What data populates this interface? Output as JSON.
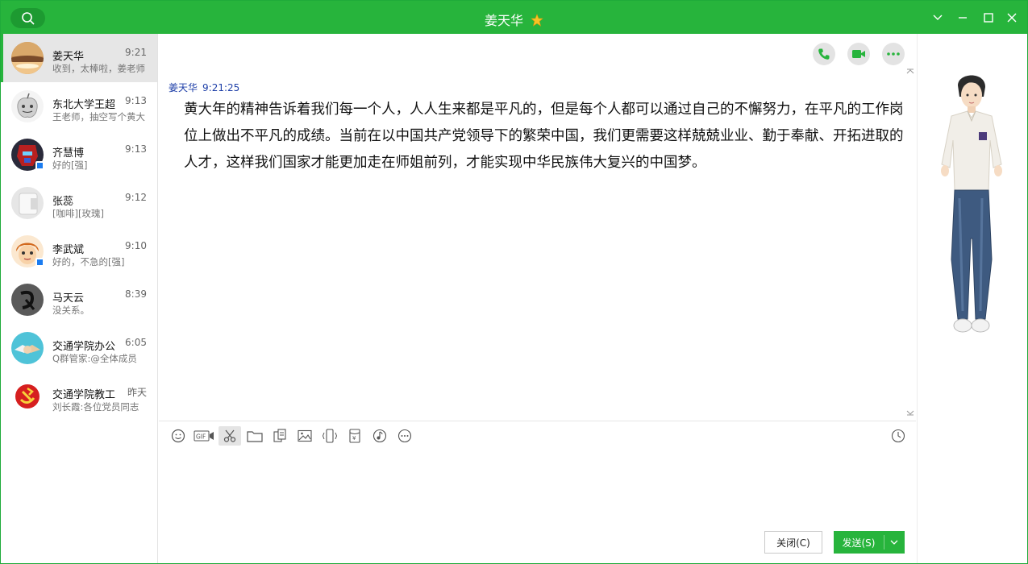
{
  "title": "姜天华",
  "colors": {
    "accent": "#27b43c",
    "sender_name": "#1e3fa8"
  },
  "conversations": [
    {
      "name": "姜天华",
      "time": "9:21",
      "preview": "收到，太棒啦，姜老师",
      "active": true,
      "avatar_icon": "sunset-avatar"
    },
    {
      "name": "东北大学王超",
      "time": "9:13",
      "preview": "王老师，抽空写个黄大",
      "avatar_icon": "apple-avatar"
    },
    {
      "name": "齐慧博",
      "time": "9:13",
      "preview": "好的[强]",
      "avatar_icon": "robot-avatar"
    },
    {
      "name": "张蕊",
      "time": "9:12",
      "preview": "[咖啡][玫瑰]",
      "avatar_icon": "default-gray-avatar"
    },
    {
      "name": "李武斌",
      "time": "9:10",
      "preview": "好的，不急的[强]",
      "avatar_icon": "cartoon-avatar"
    },
    {
      "name": "马天云",
      "time": "8:39",
      "preview": "没关系。",
      "avatar_icon": "dark-avatar"
    },
    {
      "name": "交通学院办公",
      "time": "6:05",
      "preview": "Q群管家:@全体成员",
      "avatar_icon": "handshake-avatar"
    },
    {
      "name": "交通学院教工",
      "time": "昨天",
      "preview": "刘长霞:各位党员同志",
      "avatar_icon": "party-emblem-avatar"
    }
  ],
  "message": {
    "sender": "姜天华",
    "time": "9:21:25",
    "text": "黄大年的精神告诉着我们每一个人，人人生来都是平凡的，但是每个人都可以通过自己的不懈努力，在平凡的工作岗位上做出不平凡的成绩。当前在以中国共产党领导下的繁荣中国，我们更需要这样兢兢业业、勤于奉献、开拓进取的人才，这样我们国家才能更加走在师姐前列，才能实现中华民族伟大复兴的中国梦。"
  },
  "toolbar_icons": [
    "emoji-icon",
    "gif-icon",
    "scissors-icon",
    "folder-icon",
    "doc-icon",
    "image-icon",
    "shake-icon",
    "red-packet-icon",
    "music-icon",
    "more-icon"
  ],
  "buttons": {
    "close": "关闭(C)",
    "send": "发送(S)"
  }
}
